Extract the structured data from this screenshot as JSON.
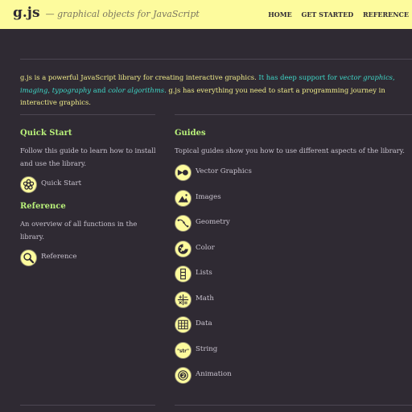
{
  "header": {
    "brand": "g.js",
    "tagline": "— graphical objects for JavaScript",
    "nav": [
      "HOME",
      "GET STARTED",
      "REFERENCE"
    ]
  },
  "intro": {
    "part1": "g.js is a powerful JavaScript library for creating interactive graphics.",
    "part2": " It has deep support for ",
    "link1": "vector graphics",
    "sep1": ", ",
    "link2": "imaging",
    "sep2": ", ",
    "link3": "typography",
    "sep3": " and ",
    "link4": "color algorithms",
    "part3": ".",
    "part4": " g.js has everything you need to start a programming journey in interactive graphics."
  },
  "quick_start": {
    "title": "Quick Start",
    "description": "Follow this guide to learn how to install and use the library.",
    "link": {
      "label": "Quick Start",
      "icon": "flower-icon"
    }
  },
  "reference": {
    "title": "Reference",
    "description": "An overview of all functions in the library.",
    "link": {
      "label": "Reference",
      "icon": "magnifier-icon"
    }
  },
  "guides": {
    "title": "Guides",
    "description": "Topical guides show you how to use different aspects of the library.",
    "items": [
      {
        "label": "Vector Graphics",
        "icon": "vector-icon"
      },
      {
        "label": "Images",
        "icon": "image-icon"
      },
      {
        "label": "Geometry",
        "icon": "geometry-icon"
      },
      {
        "label": "Color",
        "icon": "palette-icon"
      },
      {
        "label": "Lists",
        "icon": "list-icon"
      },
      {
        "label": "Math",
        "icon": "math-icon"
      },
      {
        "label": "Data",
        "icon": "data-icon"
      },
      {
        "label": "String",
        "icon": "string-icon",
        "icon_text": "\"str\""
      },
      {
        "label": "Animation",
        "icon": "animation-icon"
      }
    ]
  },
  "colors": {
    "header_bg": "#fdfb9d",
    "page_bg": "#2f2a33",
    "heading": "#b9f17a",
    "intro_accent": "#3fd8c8",
    "intro_highlight": "#f0ec8a"
  }
}
